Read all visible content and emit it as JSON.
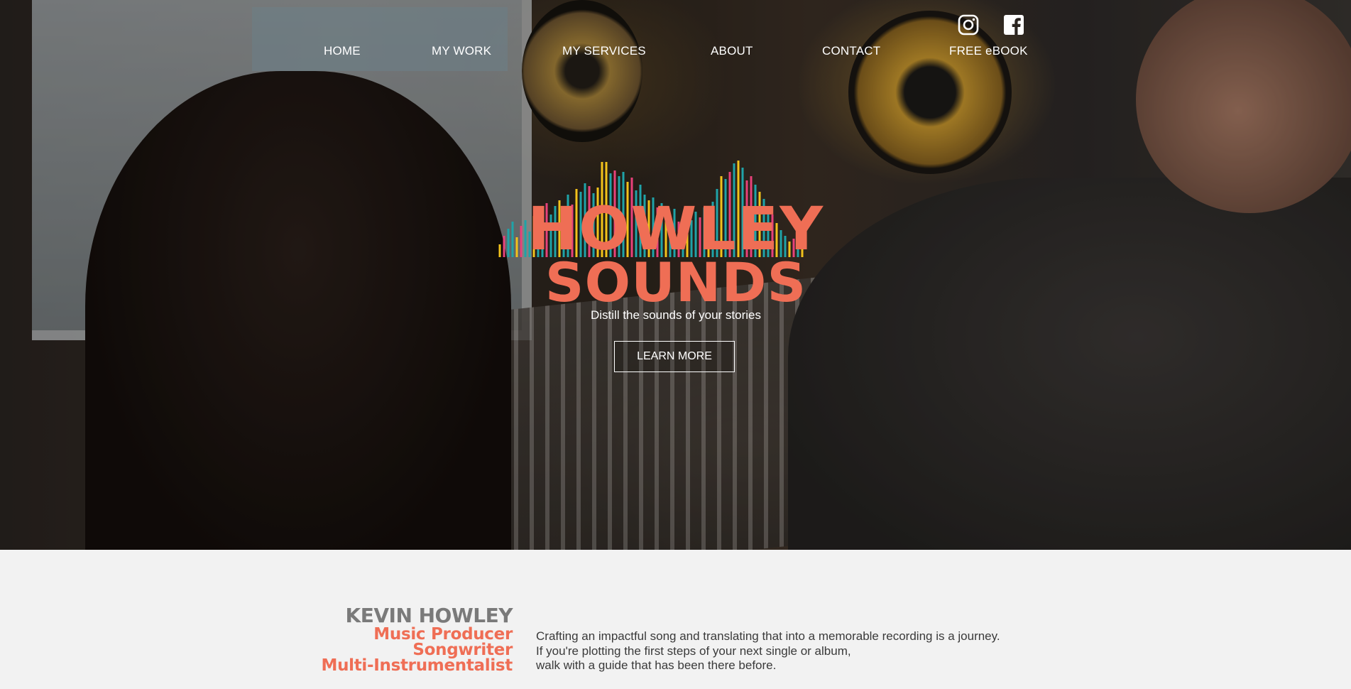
{
  "nav": {
    "items": [
      {
        "label": "HOME"
      },
      {
        "label": "MY WORK"
      },
      {
        "label": "MY SERVICES"
      },
      {
        "label": "ABOUT"
      },
      {
        "label": "CONTACT"
      },
      {
        "label": "FREE eBOOK"
      }
    ],
    "social": [
      {
        "icon": "instagram-icon"
      },
      {
        "icon": "facebook-icon"
      }
    ]
  },
  "hero": {
    "logo_line1": "HOWLEY",
    "logo_line2": "SOUNDS",
    "tagline": "Distill the sounds of your stories",
    "cta": "LEARN MORE"
  },
  "intro": {
    "name": "KEVIN HOWLEY",
    "roles": [
      "Music Producer",
      "Songwriter",
      "Multi-Instrumentalist"
    ],
    "paragraph": [
      "Crafting an impactful song and translating that into a memorable recording is a journey.",
      "If you're plotting the first steps of your next single or album,",
      "walk with a guide that has been there before."
    ]
  },
  "colors": {
    "accent": "#ef6e55",
    "teal": "#1fa3a8",
    "yellow": "#f2c21b",
    "pink": "#e8417a",
    "name_gray": "#7a7a7a"
  }
}
